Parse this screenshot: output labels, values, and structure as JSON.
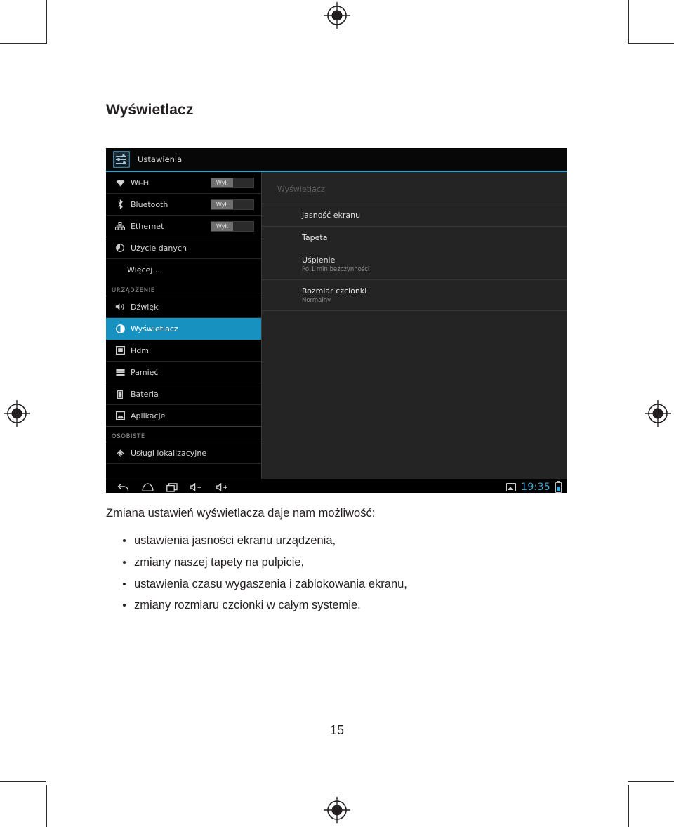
{
  "document": {
    "heading": "Wyświetlacz",
    "intro": "Zmiana ustawień wyświetlacza daje nam możliwość:",
    "bullets": [
      "ustawienia jasności ekranu urządzenia,",
      "zmiany naszej tapety na pulpicie,",
      "ustawienia czasu wygaszenia i zablokowania ekranu,",
      "zmiany rozmiaru czcionki w całym systemie."
    ],
    "page_number": "15"
  },
  "screenshot": {
    "titlebar": {
      "title": "Ustawienia",
      "icon": "settings-sliders-icon",
      "accent_color": "#27a5d4"
    },
    "sidebar": {
      "highlight_color": "#1791c0",
      "items": [
        {
          "label": "Wi-Fi",
          "icon": "wifi-icon",
          "toggle": "Wył.",
          "active": false,
          "group": null
        },
        {
          "label": "Bluetooth",
          "icon": "bluetooth-icon",
          "toggle": "Wył.",
          "active": false,
          "group": null
        },
        {
          "label": "Ethernet",
          "icon": "ethernet-icon",
          "toggle": "Wył.",
          "active": false,
          "group": null
        },
        {
          "label": "Użycie danych",
          "icon": "data-usage-icon",
          "toggle": null,
          "active": false,
          "group": null
        },
        {
          "label": "Więcej...",
          "icon": null,
          "toggle": null,
          "active": false,
          "group": null
        }
      ],
      "group_device": "URZĄDZENIE",
      "device_items": [
        {
          "label": "Dźwięk",
          "icon": "sound-icon",
          "active": false
        },
        {
          "label": "Wyświetlacz",
          "icon": "display-icon",
          "active": true
        },
        {
          "label": "Hdmi",
          "icon": "hdmi-icon",
          "active": false
        },
        {
          "label": "Pamięć",
          "icon": "storage-icon",
          "active": false
        },
        {
          "label": "Bateria",
          "icon": "battery-icon",
          "active": false
        },
        {
          "label": "Aplikacje",
          "icon": "apps-icon",
          "active": false
        }
      ],
      "group_personal": "OSOBISTE",
      "personal_items": [
        {
          "label": "Usługi lokalizacyjne",
          "icon": "location-icon",
          "active": false
        }
      ]
    },
    "content": {
      "header": "Wyświetlacz",
      "rows": [
        {
          "title": "Jasność ekranu",
          "subtitle": null
        },
        {
          "title": "Tapeta",
          "subtitle": null
        },
        {
          "title": "Uśpienie",
          "subtitle": "Po 1 min bezczynności"
        },
        {
          "title": "Rozmiar czcionki",
          "subtitle": "Normalny"
        }
      ]
    },
    "navbar": {
      "buttons": [
        {
          "name": "back-icon"
        },
        {
          "name": "home-icon"
        },
        {
          "name": "recents-icon"
        },
        {
          "name": "volume-down-icon"
        },
        {
          "name": "volume-up-icon"
        }
      ],
      "screenshot_icon": "screenshot-icon",
      "clock": "19:35",
      "clock_color": "#3ca9d6",
      "battery_icon": "battery-status-icon"
    }
  }
}
